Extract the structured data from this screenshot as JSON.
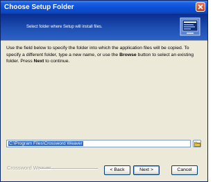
{
  "window": {
    "title": "Choose Setup Folder"
  },
  "header": {
    "subtitle": "Select folder where Setup will install files."
  },
  "body": {
    "instructions_part1": "Use the field below to specify the folder into which the application files will be copied. To specify a different folder, type a new name, or use the ",
    "browse_word": "Browse",
    "instructions_part2": " button to select an existing folder.  Press ",
    "next_word": "Next",
    "instructions_part3": " to continue."
  },
  "install_path": {
    "value": "C:\\Program Files\\Crossword Weaver"
  },
  "footer": {
    "brand": "Crossword Weaver",
    "back_label": "< Back",
    "next_label": "Next >",
    "cancel_label": "Cancel"
  },
  "icons": {
    "close": "close-icon",
    "header": "setup-computer-icon",
    "browse": "folder-icon"
  },
  "colors": {
    "title_bar": "#0a4fd6",
    "header_band": "#1e4fb3",
    "dialog_face": "#ece9d8",
    "selection": "#316ac5"
  }
}
